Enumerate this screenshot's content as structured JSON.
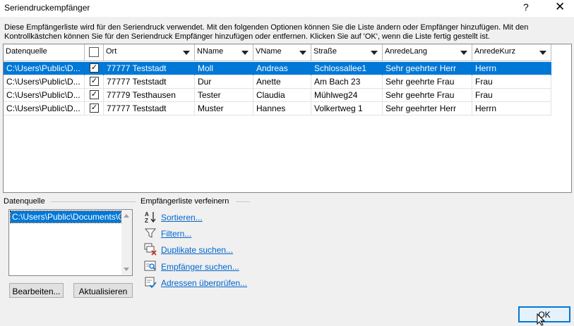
{
  "window": {
    "title": "Seriendruckempfänger",
    "help_glyph": "?",
    "close_glyph": "✕"
  },
  "description": "Diese Empfängerliste wird für den Seriendruck verwendet. Mit den folgenden Optionen können Sie die Liste ändern oder Empfänger hinzufügen. Mit den Kontrollkästchen können Sie für den Seriendruck Empfänger hinzufügen oder entfernen. Klicken Sie auf 'OK', wenn die Liste fertig gestellt ist.",
  "table": {
    "headers": [
      "Datenquelle",
      "",
      "Ort",
      "NName",
      "VName",
      "Straße",
      "AnredeLang",
      "AnredeKurz"
    ],
    "rows": [
      {
        "source": "C:\\Users\\Public\\D...",
        "checked": true,
        "ort": "77777 Teststadt",
        "nname": "Moll",
        "vname": "Andreas",
        "strasse": "Schlossallee1",
        "anredelang": "Sehr geehrter Herr",
        "anredekurz": "Herrn",
        "selected": true
      },
      {
        "source": "C:\\Users\\Public\\D...",
        "checked": true,
        "ort": "77777 Teststadt",
        "nname": "Dur",
        "vname": "Anette",
        "strasse": "Am Bach 23",
        "anredelang": "Sehr geehrte Frau",
        "anredekurz": "Frau",
        "selected": false
      },
      {
        "source": "C:\\Users\\Public\\D...",
        "checked": true,
        "ort": "77779 Testhausen",
        "nname": "Tester",
        "vname": "Claudia",
        "strasse": "Mühlweg24",
        "anredelang": "Sehr geehrte Frau",
        "anredekurz": "Frau",
        "selected": false
      },
      {
        "source": "C:\\Users\\Public\\D...",
        "checked": true,
        "ort": "77777 Teststadt",
        "nname": "Muster",
        "vname": "Hannes",
        "strasse": "Volkertweg 1",
        "anredelang": "Sehr geehrter Herr",
        "anredekurz": "Herrn",
        "selected": false
      }
    ]
  },
  "datasource": {
    "label": "Datenquelle",
    "item": "C:\\Users\\Public\\Documents\\C...",
    "edit_button": "Bearbeiten...",
    "refresh_button": "Aktualisieren"
  },
  "refine": {
    "label": "Empfängerliste verfeinern",
    "actions": [
      {
        "label": "Sortieren...",
        "icon": "sort-az-icon"
      },
      {
        "label": "Filtern...",
        "icon": "filter-icon"
      },
      {
        "label": "Duplikate suchen...",
        "icon": "find-duplicates-icon"
      },
      {
        "label": "Empfänger suchen...",
        "icon": "find-recipient-icon"
      },
      {
        "label": "Adressen überprüfen...",
        "icon": "validate-addresses-icon"
      }
    ]
  },
  "ok_button": "OK",
  "colors": {
    "selection": "#0078d7",
    "link": "#0066cc"
  }
}
